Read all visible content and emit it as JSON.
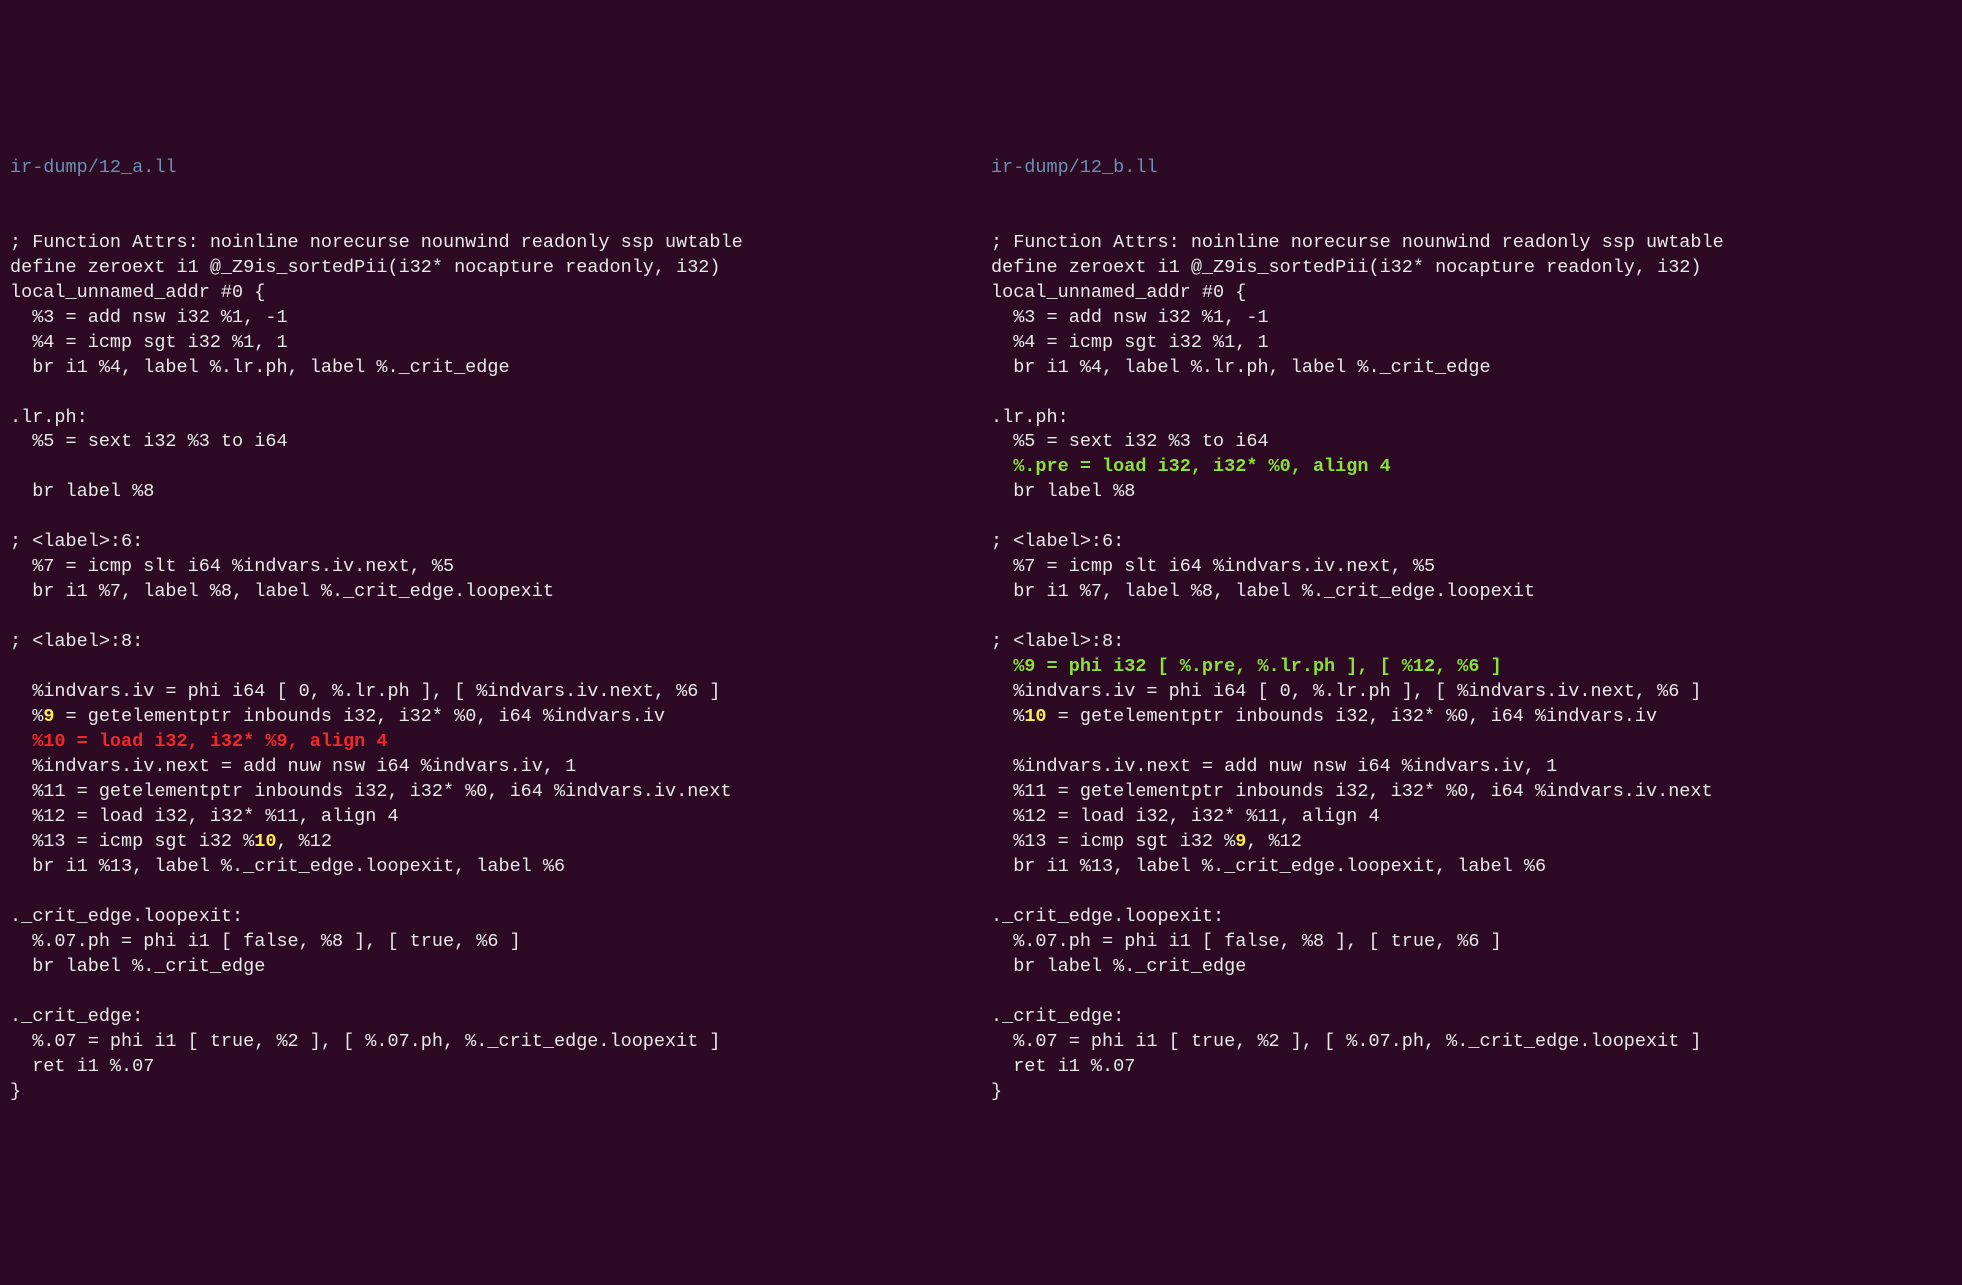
{
  "left": {
    "filename": "ir-dump/12_a.ll",
    "lines": [
      {
        "class": "line",
        "text": "; Function Attrs: noinline norecurse nounwind readonly ssp uwtable"
      },
      {
        "class": "line",
        "text": "define zeroext i1 @_Z9is_sortedPii(i32* nocapture readonly, i32)"
      },
      {
        "class": "line",
        "text": "local_unnamed_addr #0 {"
      },
      {
        "class": "line",
        "text": "  %3 = add nsw i32 %1, -1"
      },
      {
        "class": "line",
        "text": "  %4 = icmp sgt i32 %1, 1"
      },
      {
        "class": "line",
        "text": "  br i1 %4, label %.lr.ph, label %._crit_edge"
      },
      {
        "class": "line",
        "text": ""
      },
      {
        "class": "line",
        "text": ".lr.ph:"
      },
      {
        "class": "line",
        "text": "  %5 = sext i32 %3 to i64"
      },
      {
        "class": "line",
        "text": ""
      },
      {
        "class": "line",
        "text": "  br label %8"
      },
      {
        "class": "line",
        "text": ""
      },
      {
        "class": "line",
        "text": "; <label>:6:"
      },
      {
        "class": "line",
        "text": "  %7 = icmp slt i64 %indvars.iv.next, %5"
      },
      {
        "class": "line",
        "text": "  br i1 %7, label %8, label %._crit_edge.loopexit"
      },
      {
        "class": "line",
        "text": ""
      },
      {
        "class": "line",
        "text": "; <label>:8:"
      },
      {
        "class": "line",
        "text": ""
      },
      {
        "class": "line",
        "text": "  %indvars.iv = phi i64 [ 0, %.lr.ph ], [ %indvars.iv.next, %6 ]"
      },
      {
        "class": "line",
        "segments": [
          {
            "class": "line",
            "text": "  %"
          },
          {
            "class": "hl-yellow",
            "text": "9"
          },
          {
            "class": "line",
            "text": " = getelementptr inbounds i32, i32* %0, i64 %indvars.iv"
          }
        ]
      },
      {
        "class": "removed",
        "text": "  %10 = load i32, i32* %9, align 4"
      },
      {
        "class": "line",
        "text": "  %indvars.iv.next = add nuw nsw i64 %indvars.iv, 1"
      },
      {
        "class": "line",
        "text": "  %11 = getelementptr inbounds i32, i32* %0, i64 %indvars.iv.next"
      },
      {
        "class": "line",
        "text": "  %12 = load i32, i32* %11, align 4"
      },
      {
        "class": "line",
        "segments": [
          {
            "class": "line",
            "text": "  %13 = icmp sgt i32 %"
          },
          {
            "class": "hl-yellow",
            "text": "10"
          },
          {
            "class": "line",
            "text": ", %12"
          }
        ]
      },
      {
        "class": "line",
        "text": "  br i1 %13, label %._crit_edge.loopexit, label %6"
      },
      {
        "class": "line",
        "text": ""
      },
      {
        "class": "line",
        "text": "._crit_edge.loopexit:"
      },
      {
        "class": "line",
        "text": "  %.07.ph = phi i1 [ false, %8 ], [ true, %6 ]"
      },
      {
        "class": "line",
        "text": "  br label %._crit_edge"
      },
      {
        "class": "line",
        "text": ""
      },
      {
        "class": "line",
        "text": "._crit_edge:"
      },
      {
        "class": "line",
        "text": "  %.07 = phi i1 [ true, %2 ], [ %.07.ph, %._crit_edge.loopexit ]"
      },
      {
        "class": "line",
        "text": "  ret i1 %.07"
      },
      {
        "class": "line",
        "text": "}"
      }
    ]
  },
  "right": {
    "filename": "ir-dump/12_b.ll",
    "lines": [
      {
        "class": "line",
        "text": "; Function Attrs: noinline norecurse nounwind readonly ssp uwtable"
      },
      {
        "class": "line",
        "text": "define zeroext i1 @_Z9is_sortedPii(i32* nocapture readonly, i32)"
      },
      {
        "class": "line",
        "text": "local_unnamed_addr #0 {"
      },
      {
        "class": "line",
        "text": "  %3 = add nsw i32 %1, -1"
      },
      {
        "class": "line",
        "text": "  %4 = icmp sgt i32 %1, 1"
      },
      {
        "class": "line",
        "text": "  br i1 %4, label %.lr.ph, label %._crit_edge"
      },
      {
        "class": "line",
        "text": ""
      },
      {
        "class": "line",
        "text": ".lr.ph:"
      },
      {
        "class": "line",
        "text": "  %5 = sext i32 %3 to i64"
      },
      {
        "class": "added",
        "text": "  %.pre = load i32, i32* %0, align 4"
      },
      {
        "class": "line",
        "text": "  br label %8"
      },
      {
        "class": "line",
        "text": ""
      },
      {
        "class": "line",
        "text": "; <label>:6:"
      },
      {
        "class": "line",
        "text": "  %7 = icmp slt i64 %indvars.iv.next, %5"
      },
      {
        "class": "line",
        "text": "  br i1 %7, label %8, label %._crit_edge.loopexit"
      },
      {
        "class": "line",
        "text": ""
      },
      {
        "class": "line",
        "text": "; <label>:8:"
      },
      {
        "class": "added",
        "text": "  %9 = phi i32 [ %.pre, %.lr.ph ], [ %12, %6 ]"
      },
      {
        "class": "line",
        "text": "  %indvars.iv = phi i64 [ 0, %.lr.ph ], [ %indvars.iv.next, %6 ]"
      },
      {
        "class": "line",
        "segments": [
          {
            "class": "line",
            "text": "  %"
          },
          {
            "class": "hl-yellow",
            "text": "10"
          },
          {
            "class": "line",
            "text": " = getelementptr inbounds i32, i32* %0, i64 %indvars.iv"
          }
        ]
      },
      {
        "class": "line",
        "text": ""
      },
      {
        "class": "line",
        "text": "  %indvars.iv.next = add nuw nsw i64 %indvars.iv, 1"
      },
      {
        "class": "line",
        "text": "  %11 = getelementptr inbounds i32, i32* %0, i64 %indvars.iv.next"
      },
      {
        "class": "line",
        "text": "  %12 = load i32, i32* %11, align 4"
      },
      {
        "class": "line",
        "segments": [
          {
            "class": "line",
            "text": "  %13 = icmp sgt i32 %"
          },
          {
            "class": "hl-yellow",
            "text": "9"
          },
          {
            "class": "line",
            "text": ", %12"
          }
        ]
      },
      {
        "class": "line",
        "text": "  br i1 %13, label %._crit_edge.loopexit, label %6"
      },
      {
        "class": "line",
        "text": ""
      },
      {
        "class": "line",
        "text": "._crit_edge.loopexit:"
      },
      {
        "class": "line",
        "text": "  %.07.ph = phi i1 [ false, %8 ], [ true, %6 ]"
      },
      {
        "class": "line",
        "text": "  br label %._crit_edge"
      },
      {
        "class": "line",
        "text": ""
      },
      {
        "class": "line",
        "text": "._crit_edge:"
      },
      {
        "class": "line",
        "text": "  %.07 = phi i1 [ true, %2 ], [ %.07.ph, %._crit_edge.loopexit ]"
      },
      {
        "class": "line",
        "text": "  ret i1 %.07"
      },
      {
        "class": "line",
        "text": "}"
      }
    ]
  }
}
